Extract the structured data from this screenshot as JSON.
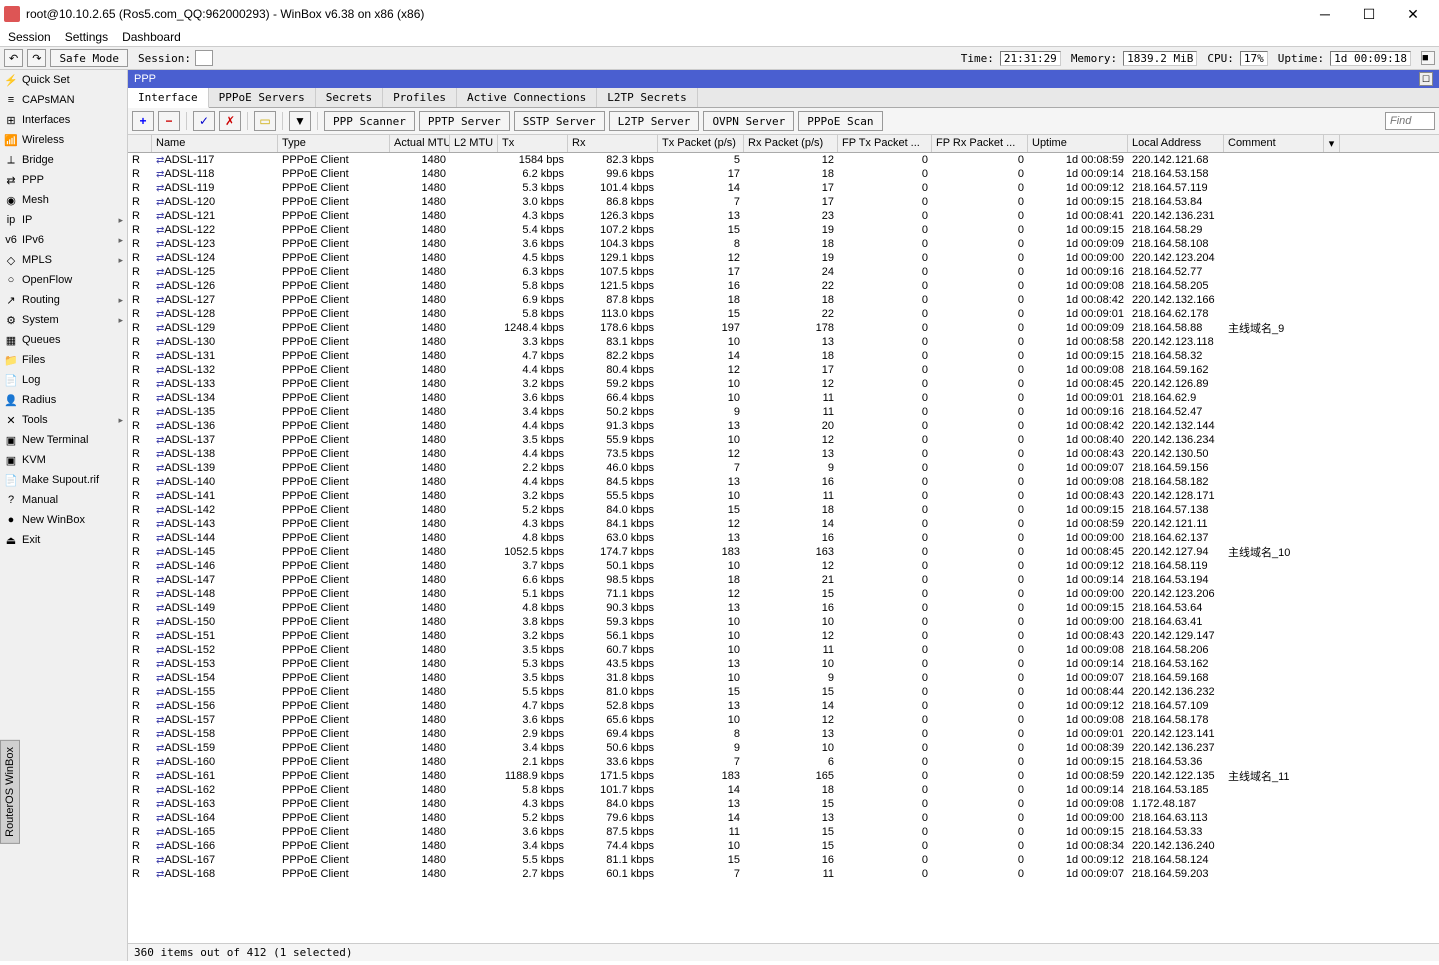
{
  "window": {
    "title": "root@10.10.2.65 (Ros5.com_QQ:962000293) - WinBox v6.38 on x86 (x86)"
  },
  "menu": [
    "Session",
    "Settings",
    "Dashboard"
  ],
  "toolbar": {
    "back": "↶",
    "fwd": "↷",
    "safe": "Safe Mode",
    "session_label": "Session:",
    "time_label": "Time:",
    "time": "21:31:29",
    "mem_label": "Memory:",
    "mem": "1839.2 MiB",
    "cpu_label": "CPU:",
    "cpu": "17%",
    "uptime_label": "Uptime:",
    "uptime": "1d 00:09:18"
  },
  "sidebar": [
    {
      "icon": "⚡",
      "label": "Quick Set"
    },
    {
      "icon": "≡",
      "label": "CAPsMAN"
    },
    {
      "icon": "⊞",
      "label": "Interfaces"
    },
    {
      "icon": "📶",
      "label": "Wireless"
    },
    {
      "icon": "⟂",
      "label": "Bridge"
    },
    {
      "icon": "⇄",
      "label": "PPP"
    },
    {
      "icon": "◉",
      "label": "Mesh"
    },
    {
      "icon": "ip",
      "label": "IP",
      "sub": true
    },
    {
      "icon": "v6",
      "label": "IPv6",
      "sub": true
    },
    {
      "icon": "◇",
      "label": "MPLS",
      "sub": true
    },
    {
      "icon": "○",
      "label": "OpenFlow"
    },
    {
      "icon": "↗",
      "label": "Routing",
      "sub": true
    },
    {
      "icon": "⚙",
      "label": "System",
      "sub": true
    },
    {
      "icon": "▦",
      "label": "Queues"
    },
    {
      "icon": "📁",
      "label": "Files"
    },
    {
      "icon": "📄",
      "label": "Log"
    },
    {
      "icon": "👤",
      "label": "Radius"
    },
    {
      "icon": "✕",
      "label": "Tools",
      "sub": true
    },
    {
      "icon": "▣",
      "label": "New Terminal"
    },
    {
      "icon": "▣",
      "label": "KVM"
    },
    {
      "icon": "📄",
      "label": "Make Supout.rif"
    },
    {
      "icon": "?",
      "label": "Manual"
    },
    {
      "icon": "●",
      "label": "New WinBox"
    },
    {
      "icon": "⏏",
      "label": "Exit"
    }
  ],
  "sidetab": "RouterOS WinBox",
  "panel": {
    "title": "PPP",
    "tabs": [
      "Interface",
      "PPPoE Servers",
      "Secrets",
      "Profiles",
      "Active Connections",
      "L2TP Secrets"
    ],
    "active_tab": 0
  },
  "tb2": {
    "buttons": [
      "PPP Scanner",
      "PPTP Server",
      "SSTP Server",
      "L2TP Server",
      "OVPN Server",
      "PPPoE Scan"
    ],
    "find": "Find"
  },
  "columns": [
    "",
    "Name",
    "Type",
    "Actual MTU",
    "L2 MTU",
    "Tx",
    "Rx",
    "Tx Packet (p/s)",
    "Rx Packet (p/s)",
    "FP Tx Packet ...",
    "FP Rx Packet ...",
    "Uptime",
    "Local Address",
    "Comment"
  ],
  "type_label": "PPPoE Client",
  "rows": [
    {
      "n": "ADSL-117",
      "mtu": "1480",
      "tx": "1584 bps",
      "rx": "82.3 kbps",
      "txp": "5",
      "rxp": "12",
      "fptx": "0",
      "fprx": "0",
      "up": "1d 00:08:59",
      "loc": "220.142.121.68",
      "c": ""
    },
    {
      "n": "ADSL-118",
      "mtu": "1480",
      "tx": "6.2 kbps",
      "rx": "99.6 kbps",
      "txp": "17",
      "rxp": "18",
      "fptx": "0",
      "fprx": "0",
      "up": "1d 00:09:14",
      "loc": "218.164.53.158",
      "c": ""
    },
    {
      "n": "ADSL-119",
      "mtu": "1480",
      "tx": "5.3 kbps",
      "rx": "101.4 kbps",
      "txp": "14",
      "rxp": "17",
      "fptx": "0",
      "fprx": "0",
      "up": "1d 00:09:12",
      "loc": "218.164.57.119",
      "c": ""
    },
    {
      "n": "ADSL-120",
      "mtu": "1480",
      "tx": "3.0 kbps",
      "rx": "86.8 kbps",
      "txp": "7",
      "rxp": "17",
      "fptx": "0",
      "fprx": "0",
      "up": "1d 00:09:15",
      "loc": "218.164.53.84",
      "c": ""
    },
    {
      "n": "ADSL-121",
      "mtu": "1480",
      "tx": "4.3 kbps",
      "rx": "126.3 kbps",
      "txp": "13",
      "rxp": "23",
      "fptx": "0",
      "fprx": "0",
      "up": "1d 00:08:41",
      "loc": "220.142.136.231",
      "c": ""
    },
    {
      "n": "ADSL-122",
      "mtu": "1480",
      "tx": "5.4 kbps",
      "rx": "107.2 kbps",
      "txp": "15",
      "rxp": "19",
      "fptx": "0",
      "fprx": "0",
      "up": "1d 00:09:15",
      "loc": "218.164.58.29",
      "c": ""
    },
    {
      "n": "ADSL-123",
      "mtu": "1480",
      "tx": "3.6 kbps",
      "rx": "104.3 kbps",
      "txp": "8",
      "rxp": "18",
      "fptx": "0",
      "fprx": "0",
      "up": "1d 00:09:09",
      "loc": "218.164.58.108",
      "c": ""
    },
    {
      "n": "ADSL-124",
      "mtu": "1480",
      "tx": "4.5 kbps",
      "rx": "129.1 kbps",
      "txp": "12",
      "rxp": "19",
      "fptx": "0",
      "fprx": "0",
      "up": "1d 00:09:00",
      "loc": "220.142.123.204",
      "c": ""
    },
    {
      "n": "ADSL-125",
      "mtu": "1480",
      "tx": "6.3 kbps",
      "rx": "107.5 kbps",
      "txp": "17",
      "rxp": "24",
      "fptx": "0",
      "fprx": "0",
      "up": "1d 00:09:16",
      "loc": "218.164.52.77",
      "c": ""
    },
    {
      "n": "ADSL-126",
      "mtu": "1480",
      "tx": "5.8 kbps",
      "rx": "121.5 kbps",
      "txp": "16",
      "rxp": "22",
      "fptx": "0",
      "fprx": "0",
      "up": "1d 00:09:08",
      "loc": "218.164.58.205",
      "c": ""
    },
    {
      "n": "ADSL-127",
      "mtu": "1480",
      "tx": "6.9 kbps",
      "rx": "87.8 kbps",
      "txp": "18",
      "rxp": "18",
      "fptx": "0",
      "fprx": "0",
      "up": "1d 00:08:42",
      "loc": "220.142.132.166",
      "c": ""
    },
    {
      "n": "ADSL-128",
      "mtu": "1480",
      "tx": "5.8 kbps",
      "rx": "113.0 kbps",
      "txp": "15",
      "rxp": "22",
      "fptx": "0",
      "fprx": "0",
      "up": "1d 00:09:01",
      "loc": "218.164.62.178",
      "c": ""
    },
    {
      "n": "ADSL-129",
      "mtu": "1480",
      "tx": "1248.4 kbps",
      "rx": "178.6 kbps",
      "txp": "197",
      "rxp": "178",
      "fptx": "0",
      "fprx": "0",
      "up": "1d 00:09:09",
      "loc": "218.164.58.88",
      "c": "主线域名_9"
    },
    {
      "n": "ADSL-130",
      "mtu": "1480",
      "tx": "3.3 kbps",
      "rx": "83.1 kbps",
      "txp": "10",
      "rxp": "13",
      "fptx": "0",
      "fprx": "0",
      "up": "1d 00:08:58",
      "loc": "220.142.123.118",
      "c": ""
    },
    {
      "n": "ADSL-131",
      "mtu": "1480",
      "tx": "4.7 kbps",
      "rx": "82.2 kbps",
      "txp": "14",
      "rxp": "18",
      "fptx": "0",
      "fprx": "0",
      "up": "1d 00:09:15",
      "loc": "218.164.58.32",
      "c": ""
    },
    {
      "n": "ADSL-132",
      "mtu": "1480",
      "tx": "4.4 kbps",
      "rx": "80.4 kbps",
      "txp": "12",
      "rxp": "17",
      "fptx": "0",
      "fprx": "0",
      "up": "1d 00:09:08",
      "loc": "218.164.59.162",
      "c": ""
    },
    {
      "n": "ADSL-133",
      "mtu": "1480",
      "tx": "3.2 kbps",
      "rx": "59.2 kbps",
      "txp": "10",
      "rxp": "12",
      "fptx": "0",
      "fprx": "0",
      "up": "1d 00:08:45",
      "loc": "220.142.126.89",
      "c": ""
    },
    {
      "n": "ADSL-134",
      "mtu": "1480",
      "tx": "3.6 kbps",
      "rx": "66.4 kbps",
      "txp": "10",
      "rxp": "11",
      "fptx": "0",
      "fprx": "0",
      "up": "1d 00:09:01",
      "loc": "218.164.62.9",
      "c": ""
    },
    {
      "n": "ADSL-135",
      "mtu": "1480",
      "tx": "3.4 kbps",
      "rx": "50.2 kbps",
      "txp": "9",
      "rxp": "11",
      "fptx": "0",
      "fprx": "0",
      "up": "1d 00:09:16",
      "loc": "218.164.52.47",
      "c": ""
    },
    {
      "n": "ADSL-136",
      "mtu": "1480",
      "tx": "4.4 kbps",
      "rx": "91.3 kbps",
      "txp": "13",
      "rxp": "20",
      "fptx": "0",
      "fprx": "0",
      "up": "1d 00:08:42",
      "loc": "220.142.132.144",
      "c": ""
    },
    {
      "n": "ADSL-137",
      "mtu": "1480",
      "tx": "3.5 kbps",
      "rx": "55.9 kbps",
      "txp": "10",
      "rxp": "12",
      "fptx": "0",
      "fprx": "0",
      "up": "1d 00:08:40",
      "loc": "220.142.136.234",
      "c": ""
    },
    {
      "n": "ADSL-138",
      "mtu": "1480",
      "tx": "4.4 kbps",
      "rx": "73.5 kbps",
      "txp": "12",
      "rxp": "13",
      "fptx": "0",
      "fprx": "0",
      "up": "1d 00:08:43",
      "loc": "220.142.130.50",
      "c": ""
    },
    {
      "n": "ADSL-139",
      "mtu": "1480",
      "tx": "2.2 kbps",
      "rx": "46.0 kbps",
      "txp": "7",
      "rxp": "9",
      "fptx": "0",
      "fprx": "0",
      "up": "1d 00:09:07",
      "loc": "218.164.59.156",
      "c": ""
    },
    {
      "n": "ADSL-140",
      "mtu": "1480",
      "tx": "4.4 kbps",
      "rx": "84.5 kbps",
      "txp": "13",
      "rxp": "16",
      "fptx": "0",
      "fprx": "0",
      "up": "1d 00:09:08",
      "loc": "218.164.58.182",
      "c": ""
    },
    {
      "n": "ADSL-141",
      "mtu": "1480",
      "tx": "3.2 kbps",
      "rx": "55.5 kbps",
      "txp": "10",
      "rxp": "11",
      "fptx": "0",
      "fprx": "0",
      "up": "1d 00:08:43",
      "loc": "220.142.128.171",
      "c": ""
    },
    {
      "n": "ADSL-142",
      "mtu": "1480",
      "tx": "5.2 kbps",
      "rx": "84.0 kbps",
      "txp": "15",
      "rxp": "18",
      "fptx": "0",
      "fprx": "0",
      "up": "1d 00:09:15",
      "loc": "218.164.57.138",
      "c": ""
    },
    {
      "n": "ADSL-143",
      "mtu": "1480",
      "tx": "4.3 kbps",
      "rx": "84.1 kbps",
      "txp": "12",
      "rxp": "14",
      "fptx": "0",
      "fprx": "0",
      "up": "1d 00:08:59",
      "loc": "220.142.121.11",
      "c": ""
    },
    {
      "n": "ADSL-144",
      "mtu": "1480",
      "tx": "4.8 kbps",
      "rx": "63.0 kbps",
      "txp": "13",
      "rxp": "16",
      "fptx": "0",
      "fprx": "0",
      "up": "1d 00:09:00",
      "loc": "218.164.62.137",
      "c": ""
    },
    {
      "n": "ADSL-145",
      "mtu": "1480",
      "tx": "1052.5 kbps",
      "rx": "174.7 kbps",
      "txp": "183",
      "rxp": "163",
      "fptx": "0",
      "fprx": "0",
      "up": "1d 00:08:45",
      "loc": "220.142.127.94",
      "c": "主线域名_10"
    },
    {
      "n": "ADSL-146",
      "mtu": "1480",
      "tx": "3.7 kbps",
      "rx": "50.1 kbps",
      "txp": "10",
      "rxp": "12",
      "fptx": "0",
      "fprx": "0",
      "up": "1d 00:09:12",
      "loc": "218.164.58.119",
      "c": ""
    },
    {
      "n": "ADSL-147",
      "mtu": "1480",
      "tx": "6.6 kbps",
      "rx": "98.5 kbps",
      "txp": "18",
      "rxp": "21",
      "fptx": "0",
      "fprx": "0",
      "up": "1d 00:09:14",
      "loc": "218.164.53.194",
      "c": ""
    },
    {
      "n": "ADSL-148",
      "mtu": "1480",
      "tx": "5.1 kbps",
      "rx": "71.1 kbps",
      "txp": "12",
      "rxp": "15",
      "fptx": "0",
      "fprx": "0",
      "up": "1d 00:09:00",
      "loc": "220.142.123.206",
      "c": ""
    },
    {
      "n": "ADSL-149",
      "mtu": "1480",
      "tx": "4.8 kbps",
      "rx": "90.3 kbps",
      "txp": "13",
      "rxp": "16",
      "fptx": "0",
      "fprx": "0",
      "up": "1d 00:09:15",
      "loc": "218.164.53.64",
      "c": ""
    },
    {
      "n": "ADSL-150",
      "mtu": "1480",
      "tx": "3.8 kbps",
      "rx": "59.3 kbps",
      "txp": "10",
      "rxp": "10",
      "fptx": "0",
      "fprx": "0",
      "up": "1d 00:09:00",
      "loc": "218.164.63.41",
      "c": ""
    },
    {
      "n": "ADSL-151",
      "mtu": "1480",
      "tx": "3.2 kbps",
      "rx": "56.1 kbps",
      "txp": "10",
      "rxp": "12",
      "fptx": "0",
      "fprx": "0",
      "up": "1d 00:08:43",
      "loc": "220.142.129.147",
      "c": ""
    },
    {
      "n": "ADSL-152",
      "mtu": "1480",
      "tx": "3.5 kbps",
      "rx": "60.7 kbps",
      "txp": "10",
      "rxp": "11",
      "fptx": "0",
      "fprx": "0",
      "up": "1d 00:09:08",
      "loc": "218.164.58.206",
      "c": ""
    },
    {
      "n": "ADSL-153",
      "mtu": "1480",
      "tx": "5.3 kbps",
      "rx": "43.5 kbps",
      "txp": "13",
      "rxp": "10",
      "fptx": "0",
      "fprx": "0",
      "up": "1d 00:09:14",
      "loc": "218.164.53.162",
      "c": ""
    },
    {
      "n": "ADSL-154",
      "mtu": "1480",
      "tx": "3.5 kbps",
      "rx": "31.8 kbps",
      "txp": "10",
      "rxp": "9",
      "fptx": "0",
      "fprx": "0",
      "up": "1d 00:09:07",
      "loc": "218.164.59.168",
      "c": ""
    },
    {
      "n": "ADSL-155",
      "mtu": "1480",
      "tx": "5.5 kbps",
      "rx": "81.0 kbps",
      "txp": "15",
      "rxp": "15",
      "fptx": "0",
      "fprx": "0",
      "up": "1d 00:08:44",
      "loc": "220.142.136.232",
      "c": ""
    },
    {
      "n": "ADSL-156",
      "mtu": "1480",
      "tx": "4.7 kbps",
      "rx": "52.8 kbps",
      "txp": "13",
      "rxp": "14",
      "fptx": "0",
      "fprx": "0",
      "up": "1d 00:09:12",
      "loc": "218.164.57.109",
      "c": ""
    },
    {
      "n": "ADSL-157",
      "mtu": "1480",
      "tx": "3.6 kbps",
      "rx": "65.6 kbps",
      "txp": "10",
      "rxp": "12",
      "fptx": "0",
      "fprx": "0",
      "up": "1d 00:09:08",
      "loc": "218.164.58.178",
      "c": ""
    },
    {
      "n": "ADSL-158",
      "mtu": "1480",
      "tx": "2.9 kbps",
      "rx": "69.4 kbps",
      "txp": "8",
      "rxp": "13",
      "fptx": "0",
      "fprx": "0",
      "up": "1d 00:09:01",
      "loc": "220.142.123.141",
      "c": ""
    },
    {
      "n": "ADSL-159",
      "mtu": "1480",
      "tx": "3.4 kbps",
      "rx": "50.6 kbps",
      "txp": "9",
      "rxp": "10",
      "fptx": "0",
      "fprx": "0",
      "up": "1d 00:08:39",
      "loc": "220.142.136.237",
      "c": ""
    },
    {
      "n": "ADSL-160",
      "mtu": "1480",
      "tx": "2.1 kbps",
      "rx": "33.6 kbps",
      "txp": "7",
      "rxp": "6",
      "fptx": "0",
      "fprx": "0",
      "up": "1d 00:09:15",
      "loc": "218.164.53.36",
      "c": ""
    },
    {
      "n": "ADSL-161",
      "mtu": "1480",
      "tx": "1188.9 kbps",
      "rx": "171.5 kbps",
      "txp": "183",
      "rxp": "165",
      "fptx": "0",
      "fprx": "0",
      "up": "1d 00:08:59",
      "loc": "220.142.122.135",
      "c": "主线域名_11"
    },
    {
      "n": "ADSL-162",
      "mtu": "1480",
      "tx": "5.8 kbps",
      "rx": "101.7 kbps",
      "txp": "14",
      "rxp": "18",
      "fptx": "0",
      "fprx": "0",
      "up": "1d 00:09:14",
      "loc": "218.164.53.185",
      "c": ""
    },
    {
      "n": "ADSL-163",
      "mtu": "1480",
      "tx": "4.3 kbps",
      "rx": "84.0 kbps",
      "txp": "13",
      "rxp": "15",
      "fptx": "0",
      "fprx": "0",
      "up": "1d 00:09:08",
      "loc": "1.172.48.187",
      "c": ""
    },
    {
      "n": "ADSL-164",
      "mtu": "1480",
      "tx": "5.2 kbps",
      "rx": "79.6 kbps",
      "txp": "14",
      "rxp": "13",
      "fptx": "0",
      "fprx": "0",
      "up": "1d 00:09:00",
      "loc": "218.164.63.113",
      "c": ""
    },
    {
      "n": "ADSL-165",
      "mtu": "1480",
      "tx": "3.6 kbps",
      "rx": "87.5 kbps",
      "txp": "11",
      "rxp": "15",
      "fptx": "0",
      "fprx": "0",
      "up": "1d 00:09:15",
      "loc": "218.164.53.33",
      "c": ""
    },
    {
      "n": "ADSL-166",
      "mtu": "1480",
      "tx": "3.4 kbps",
      "rx": "74.4 kbps",
      "txp": "10",
      "rxp": "15",
      "fptx": "0",
      "fprx": "0",
      "up": "1d 00:08:34",
      "loc": "220.142.136.240",
      "c": ""
    },
    {
      "n": "ADSL-167",
      "mtu": "1480",
      "tx": "5.5 kbps",
      "rx": "81.1 kbps",
      "txp": "15",
      "rxp": "16",
      "fptx": "0",
      "fprx": "0",
      "up": "1d 00:09:12",
      "loc": "218.164.58.124",
      "c": ""
    },
    {
      "n": "ADSL-168",
      "mtu": "1480",
      "tx": "2.7 kbps",
      "rx": "60.1 kbps",
      "txp": "7",
      "rxp": "11",
      "fptx": "0",
      "fprx": "0",
      "up": "1d 00:09:07",
      "loc": "218.164.59.203",
      "c": ""
    }
  ],
  "status": "360 items out of 412 (1 selected)"
}
